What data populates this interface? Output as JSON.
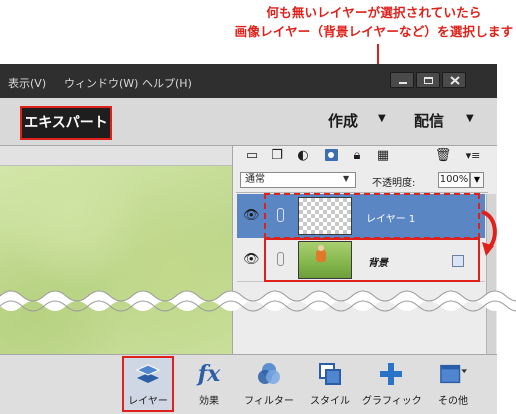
{
  "annotation": {
    "line1": "何も無いレイヤーが選択されていたら",
    "line2": "画像レイヤー（背景レイヤーなど）を選択します"
  },
  "menubar": {
    "items": [
      "表示(V)",
      "ウィンドウ(W)",
      "ヘルプ(H)"
    ]
  },
  "toolbar": {
    "mode_label": "エキスパート",
    "create_label": "作成",
    "share_label": "配信"
  },
  "layers_panel": {
    "blend_mode": "通常",
    "opacity_label": "不透明度:",
    "opacity_value": "100%",
    "layers": [
      {
        "name": "レイヤー 1",
        "selected": true
      },
      {
        "name": "背景",
        "selected": false
      }
    ]
  },
  "taskbar": {
    "items": [
      {
        "label": "レイヤー",
        "icon": "layers-icon"
      },
      {
        "label": "効果",
        "icon": "fx-icon"
      },
      {
        "label": "フィルター",
        "icon": "filter-icon"
      },
      {
        "label": "スタイル",
        "icon": "style-icon"
      },
      {
        "label": "グラフィック",
        "icon": "graphics-icon"
      },
      {
        "label": "その他",
        "icon": "more-icon"
      }
    ]
  },
  "colors": {
    "annotation_red": "#e0201a",
    "selected_layer": "#5b86c4",
    "menubar_bg": "#2f2f2f"
  }
}
